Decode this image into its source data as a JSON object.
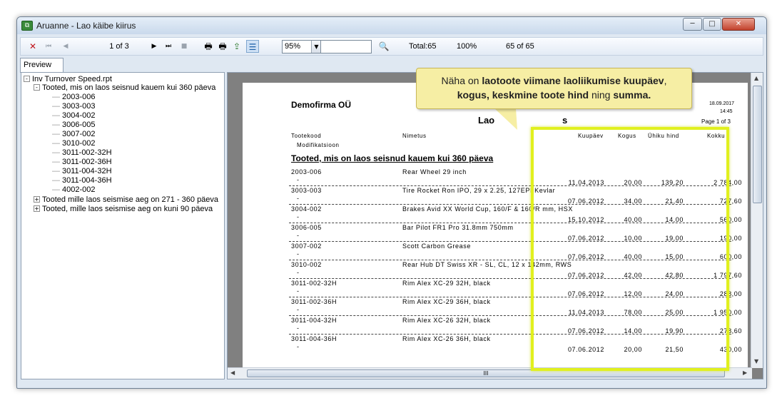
{
  "window": {
    "title": "Aruanne - Lao käibe kiirus",
    "icon": "report-app-icon",
    "controls": {
      "min_icon": "minimize-icon",
      "max_icon": "maximize-icon",
      "close_icon": "close-icon",
      "min": "─",
      "max": "□",
      "close": "✕"
    }
  },
  "toolbar": {
    "page_info": "1 of 3",
    "zoom": "95%",
    "total": "Total:65",
    "percent": "100%",
    "records": "65 of 65",
    "icons": {
      "close": "✕",
      "first": "⏮",
      "prev": "◀",
      "next": "▶",
      "last": "⏭",
      "stop": "■",
      "print": "🖶",
      "print_setup": "🖶",
      "export": "⇪",
      "tree_toggle": "☰",
      "search": "🔍",
      "dropdown": "▼"
    }
  },
  "tabs": [
    {
      "label": "Preview"
    }
  ],
  "tree": {
    "root": {
      "label": "Inv Turnover Speed.rpt",
      "sign": "-"
    },
    "group1": {
      "label": "Tooted, mis on laos seisnud kauem kui 360 päeva",
      "sign": "-"
    },
    "leaves": [
      "2003-006",
      "3003-003",
      "3004-002",
      "3006-005",
      "3007-002",
      "3010-002",
      "3011-002-32H",
      "3011-002-36H",
      "3011-004-32H",
      "3011-004-36H",
      "4002-002"
    ],
    "group2": {
      "label": "Tooted mille laos seismise aeg on 271 - 360 päeva",
      "sign": "+"
    },
    "group3": {
      "label": "Tooted, mille laos seismise aeg on kuni 90 päeva",
      "sign": "+"
    }
  },
  "report": {
    "company": "Demofirma OÜ",
    "date": "18.09.2017",
    "time": "14:45",
    "page": "Page 1 of 3",
    "title_fragment": "Lao",
    "title_fragment2": "s",
    "headers": {
      "code": "Tootekood",
      "name": "Nimetus",
      "modification": "Modifikatsioon",
      "date": "Kuupäev",
      "qty": "Kogus",
      "unit_price": "Ühiku hind",
      "total": "Kokku"
    },
    "section_title": "Tooted, mis on laos seisnud kauem kui 360 päeva",
    "rows": [
      {
        "code": "2003-006",
        "name": "Rear Wheel 29 inch",
        "mod": "-",
        "date": "11.04.2013",
        "qty": "20,00",
        "price": "139,20",
        "total": "2 784,00"
      },
      {
        "code": "3003-003",
        "name": "Tire Rocket Ron IPO, 29 x 2.25, 127EPI Kevlar",
        "mod": "-",
        "date": "07.06.2012",
        "qty": "34,00",
        "price": "21,40",
        "total": "727,60"
      },
      {
        "code": "3004-002",
        "name": "Brakes Avid XX World Cup, 160/F & 160/R mm, HSX",
        "mod": "-",
        "date": "15.10.2012",
        "qty": "40,00",
        "price": "14,00",
        "total": "560,00"
      },
      {
        "code": "3006-005",
        "name": "Bar Pilot FR1 Pro 31.8mm 750mm",
        "mod": "-",
        "date": "07.06.2012",
        "qty": "10,00",
        "price": "19,00",
        "total": "190,00"
      },
      {
        "code": "3007-002",
        "name": "Scott Carbon Grease",
        "mod": "-",
        "date": "07.06.2012",
        "qty": "40,00",
        "price": "15,00",
        "total": "600,00"
      },
      {
        "code": "3010-002",
        "name": "Rear Hub DT Swiss XR - SL, CL, 12 x 142mm, RWS",
        "mod": "-",
        "date": "07.06.2012",
        "qty": "42,00",
        "price": "42,80",
        "total": "1 797,60"
      },
      {
        "code": "3011-002-32H",
        "name": "Rim Alex XC-29 32H, black",
        "mod": "-",
        "date": "07.06.2012",
        "qty": "12,00",
        "price": "24,00",
        "total": "288,00"
      },
      {
        "code": "3011-002-36H",
        "name": "Rim Alex XC-29 36H, black",
        "mod": "-",
        "date": "11.04.2013",
        "qty": "78,00",
        "price": "25,00",
        "total": "1 950,00"
      },
      {
        "code": "3011-004-32H",
        "name": "Rim Alex XC-26 32H, black",
        "mod": "-",
        "date": "07.06.2012",
        "qty": "14,00",
        "price": "19,90",
        "total": "278,60"
      },
      {
        "code": "3011-004-36H",
        "name": "Rim Alex XC-26 36H, black",
        "mod": "-",
        "date": "07.06.2012",
        "qty": "20,00",
        "price": "21,50",
        "total": "430,00"
      }
    ]
  },
  "callout": {
    "p1": "Näha on ",
    "b1": "laotoote viimane laoliikumise kuupäev",
    "p2": ",",
    "b2": "kogus,",
    "p3": " ",
    "b3": "keskmine toote hind",
    "p4": " ning ",
    "b4": "summa.",
    "color": "#f6eea4"
  },
  "highlight_color": "#e1f01e",
  "scroll": {
    "h_grip": "III",
    "left": "◀",
    "right": "▶",
    "up": "▲",
    "down": "▼"
  }
}
